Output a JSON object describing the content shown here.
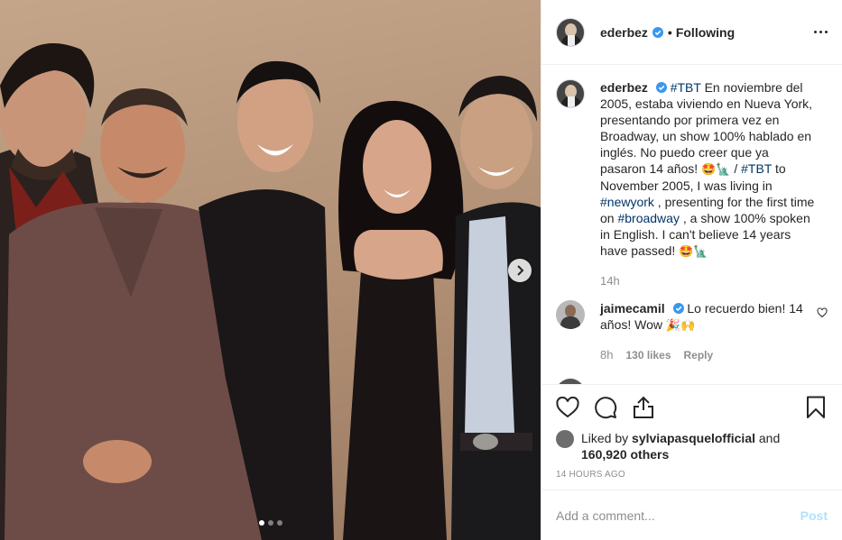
{
  "post": {
    "author": "ederbez",
    "follow_state": "Following",
    "bullet": "•",
    "caption_parts": {
      "tag1": "#TBT",
      "text1": " En noviembre del 2005, estaba viviendo en Nueva York, presentando por primera vez en Broadway, un show 100% hablado en inglés. No puedo creer que ya pasaron 14 años! ",
      "emoji1": "🤩🗽",
      "sep": " / ",
      "tag2": "#TBT",
      "text2": " to November 2005, I was living in ",
      "tag3": "#newyork",
      "text3": " , presenting for the first time on ",
      "tag4": "#broadway",
      "text4": " , a show 100% spoken in English. I can't believe 14 years have passed! ",
      "emoji2": "🤩🗽"
    },
    "caption_age": "14h",
    "comment": {
      "username": "jaimecamil",
      "text": "Lo recuerdo bien! 14 años! Wow ",
      "emoji": "🎉🙌",
      "age": "8h",
      "likes": "130 likes",
      "reply_label": "Reply"
    },
    "liked_by_prefix": "Liked by",
    "liked_by_user": "sylviapasquelofficial",
    "liked_by_and": "and",
    "likes_count": "160,920 others",
    "timestamp": "14 HOURS AGO",
    "add_comment_placeholder": "Add a comment...",
    "post_button": "Post"
  },
  "carousel": {
    "total": 3,
    "current": 1
  },
  "icons": {
    "verified": "verified-badge-icon",
    "more": "more-options-icon",
    "like": "heart-icon",
    "comment": "comment-icon",
    "share": "share-icon",
    "save": "bookmark-icon",
    "next": "chevron-right-icon"
  },
  "colors": {
    "verified_blue": "#3897f0",
    "link": "#003569",
    "muted": "#8e8e8e",
    "post_disabled": "#b2dffc"
  }
}
